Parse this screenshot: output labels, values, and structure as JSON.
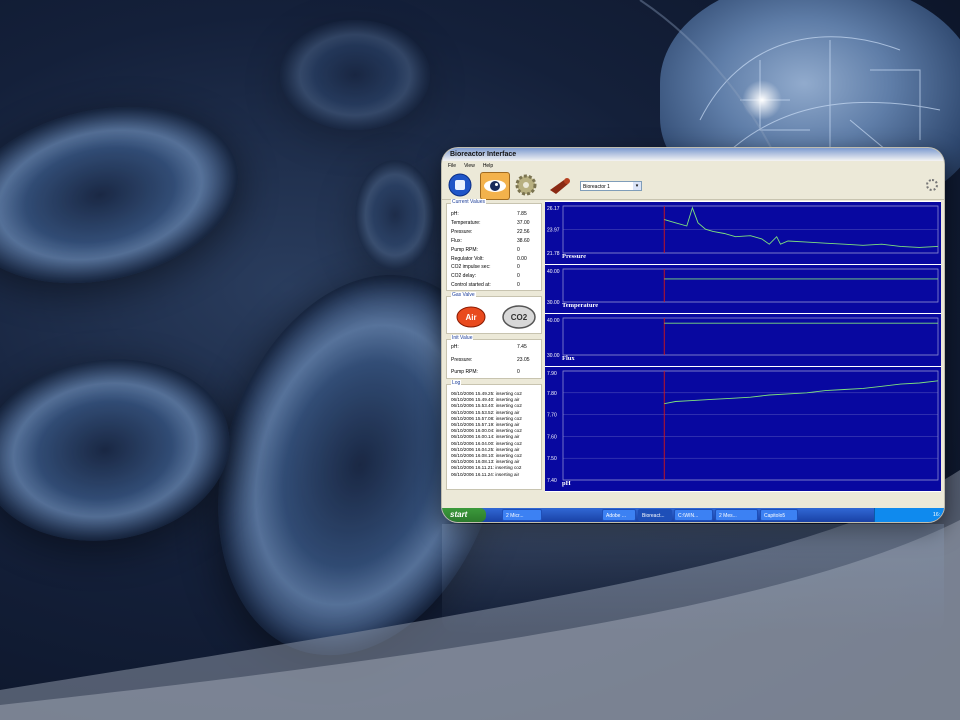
{
  "window": {
    "title": "Bioreactor Interface"
  },
  "menu": [
    "File",
    "View",
    "Help"
  ],
  "toolbar": {
    "buttons": [
      {
        "name": "stop",
        "icon": "stop-icon"
      },
      {
        "name": "monitor",
        "icon": "eye-icon"
      },
      {
        "name": "settings",
        "icon": "gear-icon"
      },
      {
        "name": "sampling",
        "icon": "pipe-icon"
      }
    ],
    "selected_reactor": "Bioreactor 1",
    "dropdown_arrow": "▾"
  },
  "current_values": {
    "title": "Current Values",
    "rows": [
      {
        "label": "pH:",
        "value": "7.85"
      },
      {
        "label": "Temperature:",
        "value": "37.00"
      },
      {
        "label": "Pressure:",
        "value": "22.56"
      },
      {
        "label": "Flux:",
        "value": "38.60"
      },
      {
        "label": "Pump RPM:",
        "value": "0"
      },
      {
        "label": "Regulator Volt:",
        "value": "0.00"
      },
      {
        "label": "CO2 impulse sec:",
        "value": "0"
      },
      {
        "label": "CO2 delay:",
        "value": "0"
      },
      {
        "label": "Control started at:",
        "value": "0"
      }
    ]
  },
  "gas_valve": {
    "title": "Gas Valve",
    "air_label": "Air",
    "co2_label": "CO2"
  },
  "init_value": {
    "title": "Init Value",
    "rows": [
      {
        "label": "pH:",
        "value": "7.45"
      },
      {
        "label": "Pressure:",
        "value": "23.05"
      },
      {
        "label": "Pump RPM:",
        "value": "0"
      }
    ]
  },
  "log": {
    "title": "Log",
    "entries": [
      "06/10/2006 15.49.25: inserting co2",
      "06/10/2006 15.49.40: inserting air",
      "06/10/2006 15.53.40: inserting co2",
      "06/10/2006 15.53.52: inserting air",
      "06/10/2006 15.57.08: inserting co2",
      "06/10/2006 15.57.19: inserting air",
      "06/10/2006 16.00.04: inserting co2",
      "06/10/2006 16.00.14: inserting air",
      "06/10/2006 16.04.00: inserting co2",
      "06/10/2006 16.04.25: inserting air",
      "06/10/2006 16.08.10: inserting co2",
      "06/10/2006 16.08.13: inserting air",
      "06/10/2006 16.11.21: inserting co2",
      "06/10/2006 16.11.24: inserting air"
    ]
  },
  "colors": {
    "plot_bg": "#0808a0",
    "series": "#7ee07e",
    "grid": "#8a8ad0",
    "marker": "#d01818"
  },
  "chart_data": [
    {
      "type": "line",
      "title": "Pressure",
      "ylim": [
        21.78,
        26.17
      ],
      "yticks": [
        "26.17",
        "23.97",
        "21.78"
      ],
      "marker_x": 0.27,
      "x": [
        0.27,
        0.3,
        0.33,
        0.345,
        0.36,
        0.38,
        0.4,
        0.43,
        0.46,
        0.5,
        0.53,
        0.55,
        0.57,
        0.58,
        0.6,
        0.65,
        0.7,
        0.75,
        0.8,
        0.85,
        0.9,
        0.95,
        1.0
      ],
      "y": [
        24.9,
        24.6,
        24.3,
        26.0,
        24.6,
        24.0,
        23.8,
        23.6,
        23.3,
        23.4,
        23.1,
        22.6,
        23.3,
        22.6,
        22.9,
        22.8,
        22.7,
        22.6,
        22.5,
        22.6,
        22.4,
        22.3,
        22.4
      ]
    },
    {
      "type": "line",
      "title": "Temperature",
      "ylim": [
        30.0,
        40.0
      ],
      "yticks": [
        "40.00",
        "30.00"
      ],
      "marker_x": 0.27,
      "x": [
        0.27,
        1.0
      ],
      "y": [
        37.0,
        37.0
      ]
    },
    {
      "type": "line",
      "title": "Flux",
      "ylim": [
        30.0,
        40.0
      ],
      "yticks": [
        "40.00",
        "30.00"
      ],
      "marker_x": 0.27,
      "x": [
        0.27,
        1.0
      ],
      "y": [
        38.6,
        38.6
      ]
    },
    {
      "type": "line",
      "title": "pH",
      "ylim": [
        7.4,
        7.9
      ],
      "yticks": [
        "7.90",
        "7.80",
        "7.70",
        "7.60",
        "7.50",
        "7.40"
      ],
      "marker_x": 0.27,
      "x": [
        0.27,
        0.3,
        0.35,
        0.4,
        0.45,
        0.5,
        0.55,
        0.6,
        0.65,
        0.7,
        0.75,
        0.8,
        0.85,
        0.9,
        0.95,
        1.0
      ],
      "y": [
        7.75,
        7.76,
        7.765,
        7.77,
        7.775,
        7.78,
        7.79,
        7.795,
        7.8,
        7.81,
        7.815,
        7.82,
        7.83,
        7.84,
        7.845,
        7.855
      ]
    }
  ],
  "taskbar": {
    "start_label": "start",
    "tasks": [
      "2 Micr...",
      "Adobe ...",
      "Bioreact...",
      "C:\\WIN...",
      "2 Mes...",
      "Capitolo5"
    ],
    "clock": "16:"
  }
}
